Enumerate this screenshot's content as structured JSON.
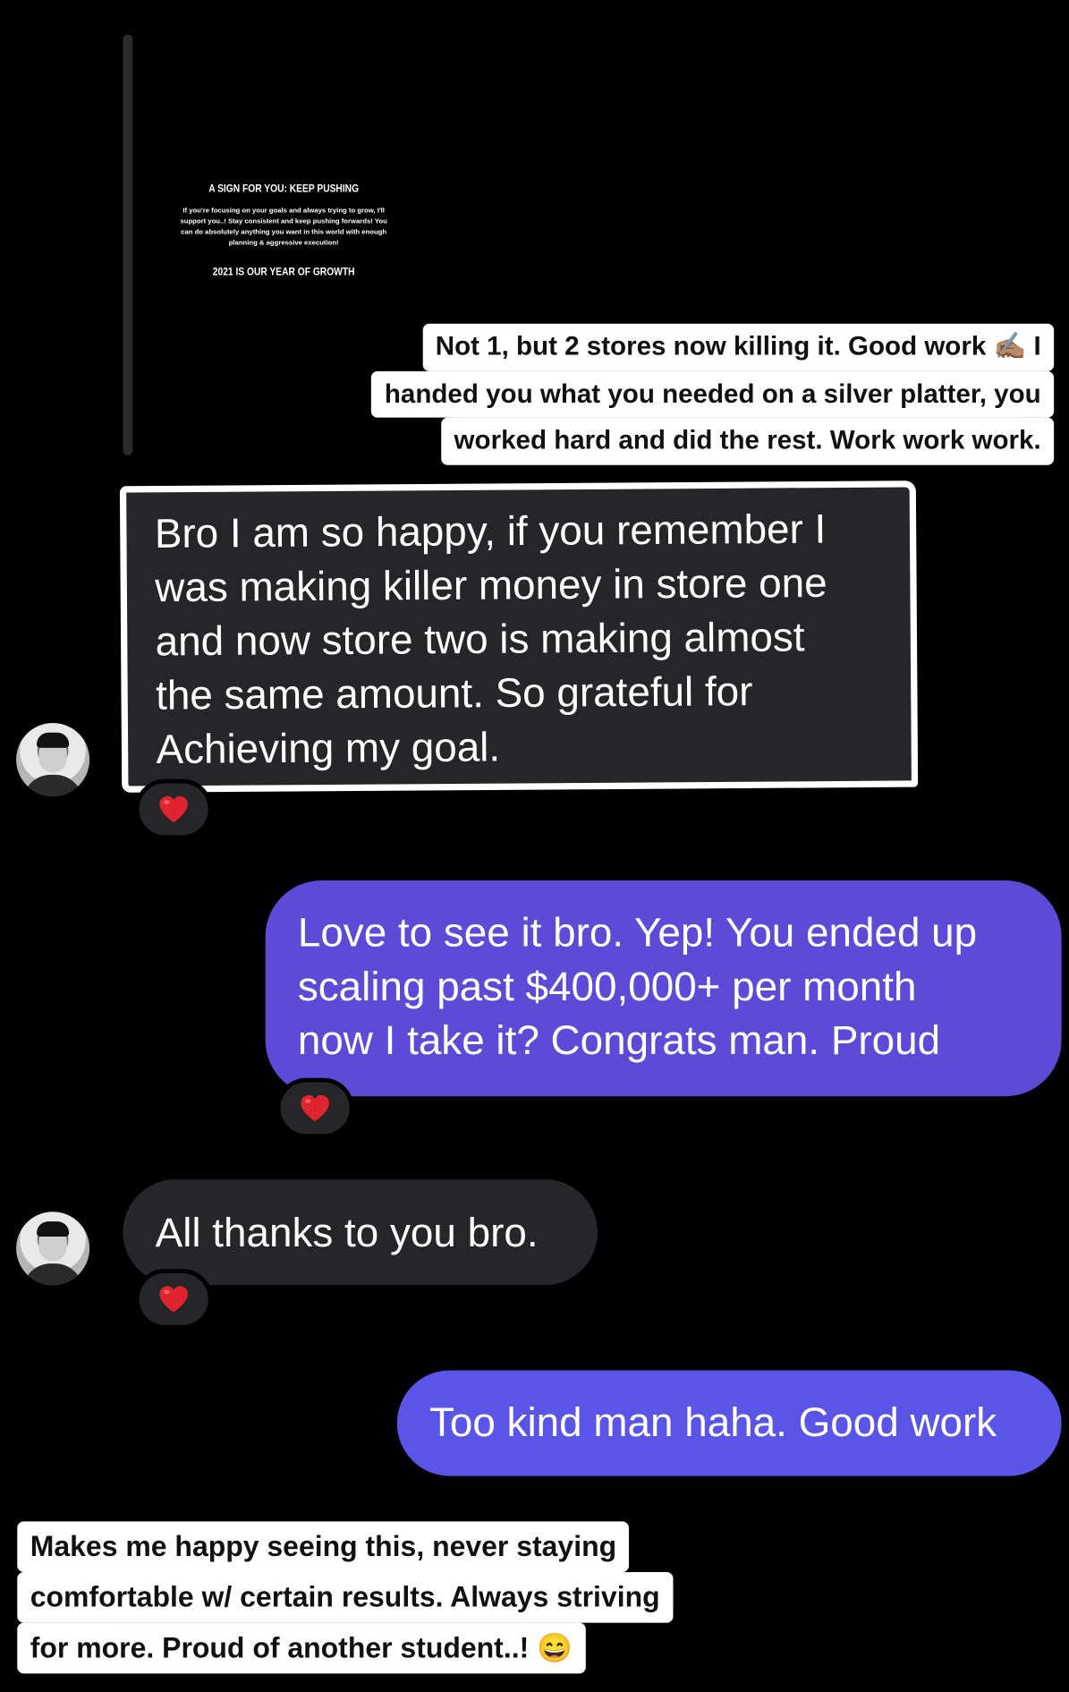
{
  "story": {
    "title": "A SIGN FOR YOU:  KEEP PUSHING",
    "body": "If you're focusing on your goals and always trying to grow, I'll support you..!  Stay consistent and keep pushing forwards! You can do absolutely anything you want in this world with enough planning & aggressive execution!",
    "footer": "2021 IS OUR YEAR OF GROWTH"
  },
  "caption_top": {
    "lines": [
      "Not 1, but 2 stores now killing it. Good work ✍🏽 I",
      "handed you what you needed on a silver platter, you",
      "worked hard and did the rest. Work work work."
    ]
  },
  "messages": [
    {
      "sender": "them",
      "text": "Bro I am so happy, if you remember I\nwas making killer money in store one\nand now  store two is making almost\nthe same amount. So grateful for\nAchieving my goal.",
      "reaction": "❤️"
    },
    {
      "sender": "me",
      "text": "Love to see it bro. Yep! You ended up\nscaling past $400,000+ per month\nnow I take it? Congrats man. Proud",
      "reaction": "❤️"
    },
    {
      "sender": "them",
      "text": "All thanks to you bro.",
      "reaction": "❤️"
    },
    {
      "sender": "me",
      "text": "Too kind man haha. Good work"
    }
  ],
  "caption_bottom": {
    "lines": [
      "Makes me happy seeing this, never staying",
      "comfortable w/ certain results. Always striving",
      "for more. Proud of another student..! 😄"
    ]
  },
  "colors": {
    "background": "#000000",
    "incoming_bubble": "#262628",
    "outgoing_bubble_1": "#5d4ad6",
    "outgoing_bubble_2": "#5a55e6",
    "reaction_heart": "#e0242f"
  },
  "icons": {
    "avatar": "user-avatar",
    "reaction": "heart-icon"
  }
}
